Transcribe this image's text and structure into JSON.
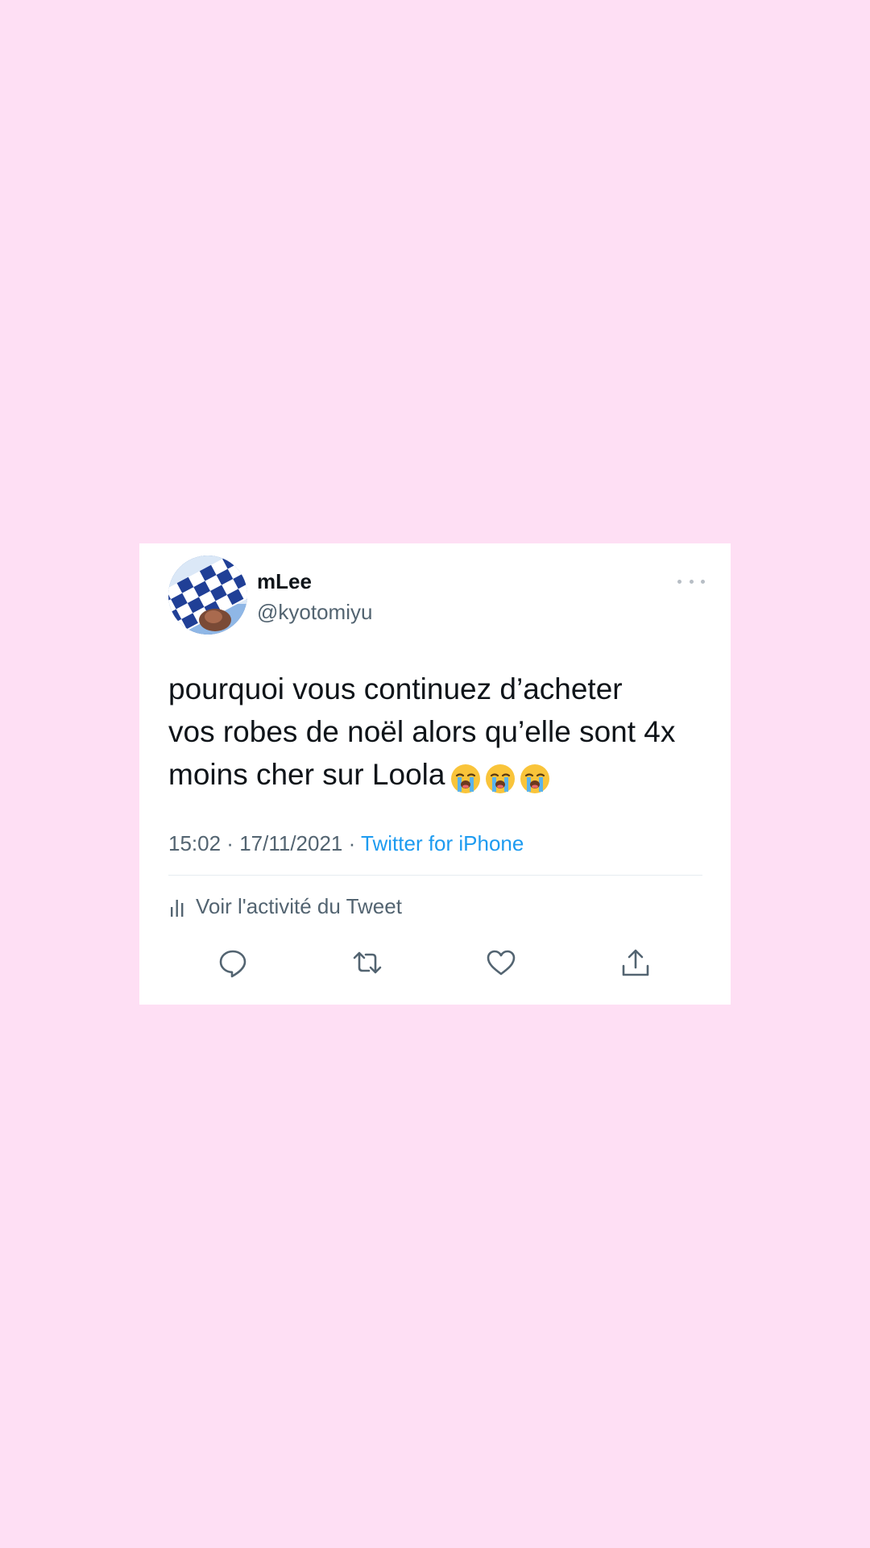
{
  "user": {
    "display_name": "mLee",
    "handle": "@kyotomiyu"
  },
  "tweet": {
    "lines": [
      "pourquoi vous continuez d’acheter",
      "vos robes de noël alors qu’elle sont 4x",
      "moins cher sur Loola"
    ],
    "emojis": [
      "loudly-crying-face-icon",
      "loudly-crying-face-icon",
      "loudly-crying-face-icon"
    ]
  },
  "meta": {
    "time": "15:02",
    "separator_1": " · ",
    "date": "17/11/2021",
    "separator_2": " · ",
    "source": "Twitter for iPhone"
  },
  "activity": {
    "label": "Voir l'activité du Tweet"
  },
  "actions": [
    "reply-icon",
    "retweet-icon",
    "like-icon",
    "share-icon"
  ],
  "colors": {
    "background": "#fedff4",
    "card": "#ffffff",
    "text": "#0f1419",
    "secondary": "#536471",
    "link": "#1d9bf0"
  }
}
